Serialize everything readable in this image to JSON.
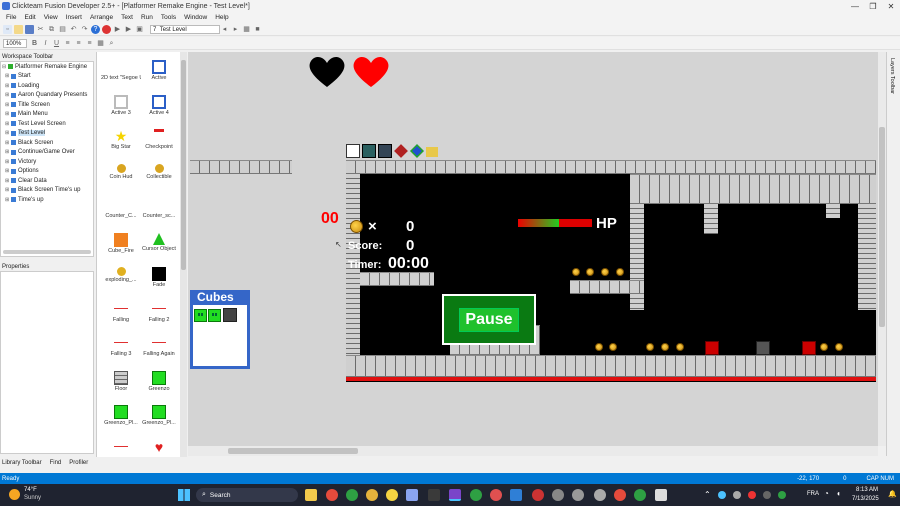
{
  "window": {
    "title": "Clickteam Fusion Developer 2.5+ - [Platformer Remake Engine - Test Level*]",
    "min": "—",
    "max": "❐",
    "close": "✕"
  },
  "menu": [
    "File",
    "Edit",
    "View",
    "Insert",
    "Arrange",
    "Text",
    "Run",
    "Tools",
    "Window",
    "Help"
  ],
  "toolbar": {
    "frame_number": "7",
    "frame_name": "Test Level",
    "zoom": "100%"
  },
  "workspace": {
    "title": "Workspace Toolbar",
    "root": "Platformer Remake Engine",
    "items": [
      "Start",
      "Loading",
      "Aaron Quandary Presents",
      "Title Screen",
      "Main Menu",
      "Test Level Screen",
      "Test Level",
      "Black Screen",
      "Continue/Game Over",
      "Victory",
      "Options",
      "Clear Data",
      "Black Screen Time's up",
      "Time's up"
    ],
    "selected": "Test Level"
  },
  "properties": {
    "title": "Properties"
  },
  "library_tabs": [
    "Library Toolbar",
    "Find",
    "Profiler"
  ],
  "objects": [
    {
      "label": "2D text \"Segoe U\"",
      "icon": "text-icon",
      "color": "#ffffff"
    },
    {
      "label": "Active",
      "icon": "active-frame-icon",
      "color": "#2b5fc7"
    },
    {
      "label": "Active 3",
      "icon": "active-frame-icon",
      "color": "#ffffff"
    },
    {
      "label": "Active 4",
      "icon": "active-frame-icon",
      "color": "#2b5fc7"
    },
    {
      "label": "Big Star",
      "icon": "star-icon",
      "color": "#f5d400"
    },
    {
      "label": "Checkpoint",
      "icon": "checkpoint-icon",
      "color": "#e02020"
    },
    {
      "label": "Coin Hud",
      "icon": "coin-icon",
      "color": "#d9a520"
    },
    {
      "label": "Collectible",
      "icon": "coin-icon",
      "color": "#d9a520"
    },
    {
      "label": "Counter_C...",
      "icon": "counter-icon",
      "color": "#ffffff"
    },
    {
      "label": "Counter_sc...",
      "icon": "counter-icon",
      "color": "#ffffff"
    },
    {
      "label": "Cube_Fire",
      "icon": "cube-fire-icon",
      "color": "#f08020"
    },
    {
      "label": "Cursor Object",
      "icon": "cursor-icon",
      "color": "#20c020"
    },
    {
      "label": "exploding_...",
      "icon": "explosion-icon",
      "color": "#e0b020"
    },
    {
      "label": "Fade",
      "icon": "fade-icon",
      "color": "#000000"
    },
    {
      "label": "Falling",
      "icon": "line-icon",
      "color": "#e03030"
    },
    {
      "label": "Falling 2",
      "icon": "line-icon",
      "color": "#e03030"
    },
    {
      "label": "Falling 3",
      "icon": "line-icon",
      "color": "#e03030"
    },
    {
      "label": "Falling Again",
      "icon": "line-icon",
      "color": "#e03030"
    },
    {
      "label": "Floor",
      "icon": "floor-icon",
      "color": "#888888"
    },
    {
      "label": "Greenzo",
      "icon": "greenzo-icon",
      "color": "#22dd22"
    },
    {
      "label": "Greenzo_Pl...",
      "icon": "greenzo-icon",
      "color": "#22dd22"
    },
    {
      "label": "Greenzo_Pl...",
      "icon": "greenzo-icon",
      "color": "#22dd22"
    },
    {
      "label": "",
      "icon": "line-icon",
      "color": "#e03030"
    },
    {
      "label": "",
      "icon": "heart-icon",
      "color": "#e02020"
    }
  ],
  "game": {
    "hp_label": "HP",
    "coin_count_x": "×",
    "coin_count": "0",
    "score_label": "Score:",
    "score_value": "0",
    "timer_label": "Timer:",
    "timer_value": "00:00",
    "red_counter": "00",
    "pause_label": "Pause",
    "cubes_label": "Cubes",
    "hp_fill": 0.55
  },
  "status": {
    "left": "Ready",
    "coords": "-22, 170",
    "flags": "0",
    "caps": "CAP NUM"
  },
  "taskbar": {
    "weather_temp": "74°F",
    "weather_desc": "Sunny",
    "search": "Search",
    "lang": "FRA",
    "time": "8:13 AM",
    "date": "7/13/2025"
  }
}
